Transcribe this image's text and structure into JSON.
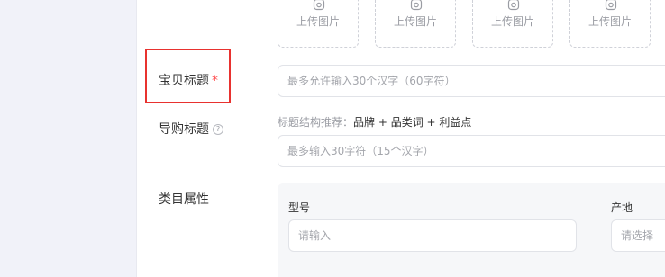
{
  "uploads": {
    "items": [
      {
        "label": "上传图片"
      },
      {
        "label": "上传图片"
      },
      {
        "label": "上传图片"
      },
      {
        "label": "上传图片"
      }
    ]
  },
  "form": {
    "title": {
      "label": "宝贝标题",
      "required_mark": "*",
      "placeholder": "最多允许输入30个汉字（60字符）"
    },
    "guide_title": {
      "label": "导购标题",
      "help_icon": "?",
      "hint_prefix": "标题结构推荐：",
      "hint_body": "品牌 + 品类词 + 利益点",
      "placeholder": "最多输入30字符（15个汉字）"
    },
    "category_attrs": {
      "label": "类目属性",
      "model": {
        "label": "型号",
        "placeholder": "请输入"
      },
      "origin": {
        "label": "产地",
        "placeholder": "请选择"
      }
    }
  },
  "colors": {
    "highlight": "#e8322f",
    "required": "#ff4d4f",
    "panel_bg": "#f6f7f9",
    "sidebar_bg": "#f1f2f9"
  },
  "icons": {
    "upload": "image-upload-icon",
    "help": "question-circle-icon"
  }
}
